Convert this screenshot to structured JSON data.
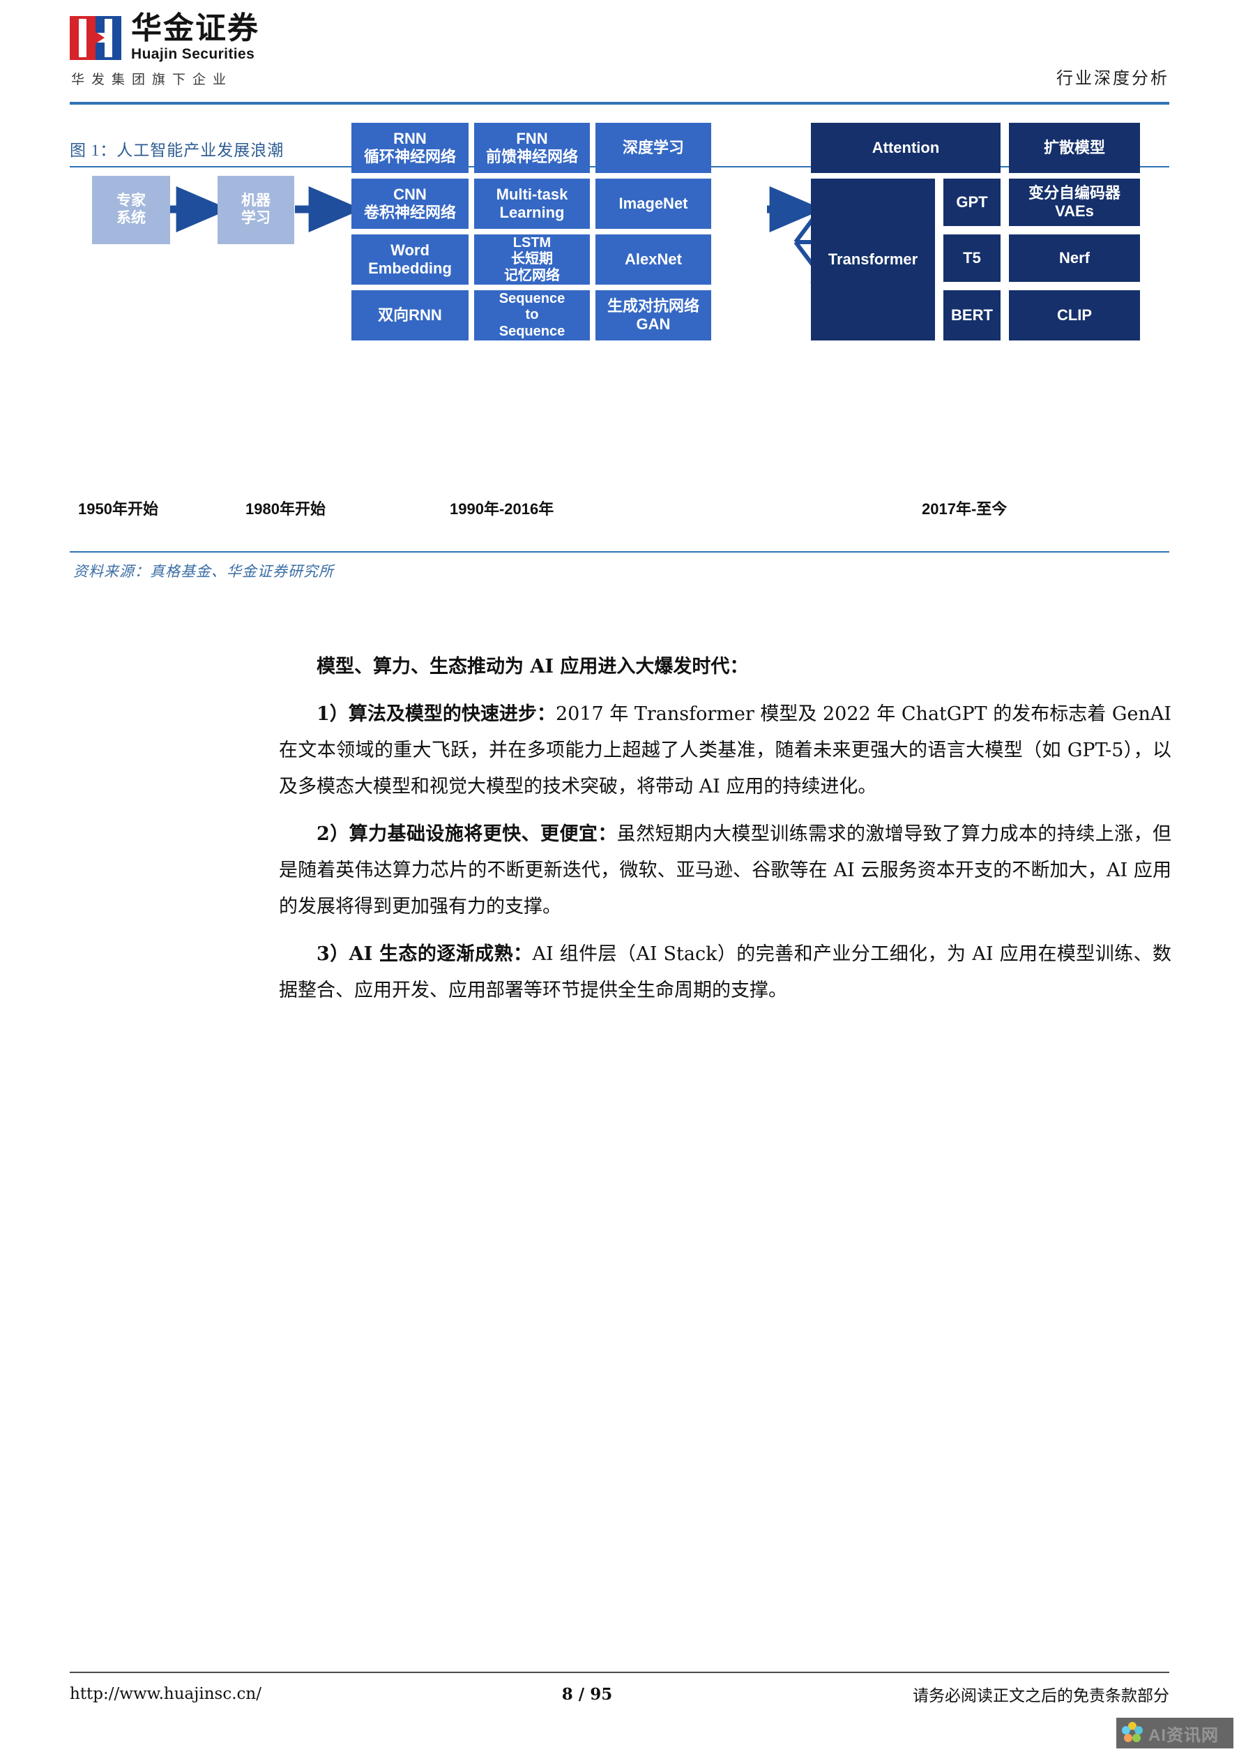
{
  "header": {
    "logo_cn": "华金证券",
    "logo_en": "Huajin Securities",
    "logo_sub": "华发集团旗下企业",
    "report_type": "行业深度分析"
  },
  "figure": {
    "title": "图 1：人工智能产业发展浪潮",
    "source": "资料来源：真格基金、华金证券研究所",
    "timeline": [
      {
        "label": "1950年开始"
      },
      {
        "label": "1980年开始"
      },
      {
        "label": "1990年-2016年"
      },
      {
        "label": "2017年-至今"
      }
    ],
    "stage1": {
      "label": "专家\n系统"
    },
    "stage2": {
      "label": "机器\n学习"
    },
    "grid": [
      {
        "label": "RNN\n循环神经网络"
      },
      {
        "label": "FNN\n前馈神经网络"
      },
      {
        "label": "深度学习"
      },
      {
        "label": "CNN\n卷积神经网络"
      },
      {
        "label": "Multi-task\nLearning"
      },
      {
        "label": "ImageNet"
      },
      {
        "label": "Word\nEmbedding"
      },
      {
        "label": "LSTM\n长短期\n记忆网络"
      },
      {
        "label": "AlexNet"
      },
      {
        "label": "双向RNN"
      },
      {
        "label": "Sequence\nto\nSequence"
      },
      {
        "label": "生成对抗网络\nGAN"
      }
    ],
    "attention": {
      "label": "Attention"
    },
    "diffusion": {
      "label": "扩散模型"
    },
    "transformer": {
      "label": "Transformer"
    },
    "branches": [
      {
        "label": "GPT"
      },
      {
        "label": "T5"
      },
      {
        "label": "BERT"
      }
    ],
    "rightcol": [
      {
        "label": "变分自编码器\nVAEs"
      },
      {
        "label": "Nerf"
      },
      {
        "label": "CLIP"
      }
    ],
    "colors": {
      "light_box": "#a3b8dc",
      "mid_box": "#3568c4",
      "dark_box": "#15306b",
      "arrow": "#1f4e9c"
    }
  },
  "body": {
    "lead": "模型、算力、生态推动为 AI 应用进入大爆发时代：",
    "p1_bold": "1）算法及模型的快速进步：",
    "p1_rest": "2017 年 Transformer 模型及 2022 年 ChatGPT 的发布标志着 GenAI 在文本领域的重大飞跃，并在多项能力上超越了人类基准，随着未来更强大的语言大模型（如 GPT-5），以及多模态大模型和视觉大模型的技术突破，将带动 AI 应用的持续进化。",
    "p2_bold": "2）算力基础设施将更快、更便宜：",
    "p2_rest": "虽然短期内大模型训练需求的激增导致了算力成本的持续上涨，但是随着英伟达算力芯片的不断更新迭代，微软、亚马逊、谷歌等在 AI 云服务资本开支的不断加大，AI 应用的发展将得到更加强有力的支撑。",
    "p3_bold": "3）AI 生态的逐渐成熟：",
    "p3_rest": "AI 组件层（AI Stack）的完善和产业分工细化，为 AI 应用在模型训练、数据整合、应用开发、应用部署等环节提供全生命周期的支撑。"
  },
  "footer": {
    "url": "http://www.huajinsc.cn/",
    "page": "8 / 95",
    "disclaimer": "请务必阅读正文之后的免责条款部分"
  },
  "watermark": {
    "text": "AI资讯网"
  }
}
